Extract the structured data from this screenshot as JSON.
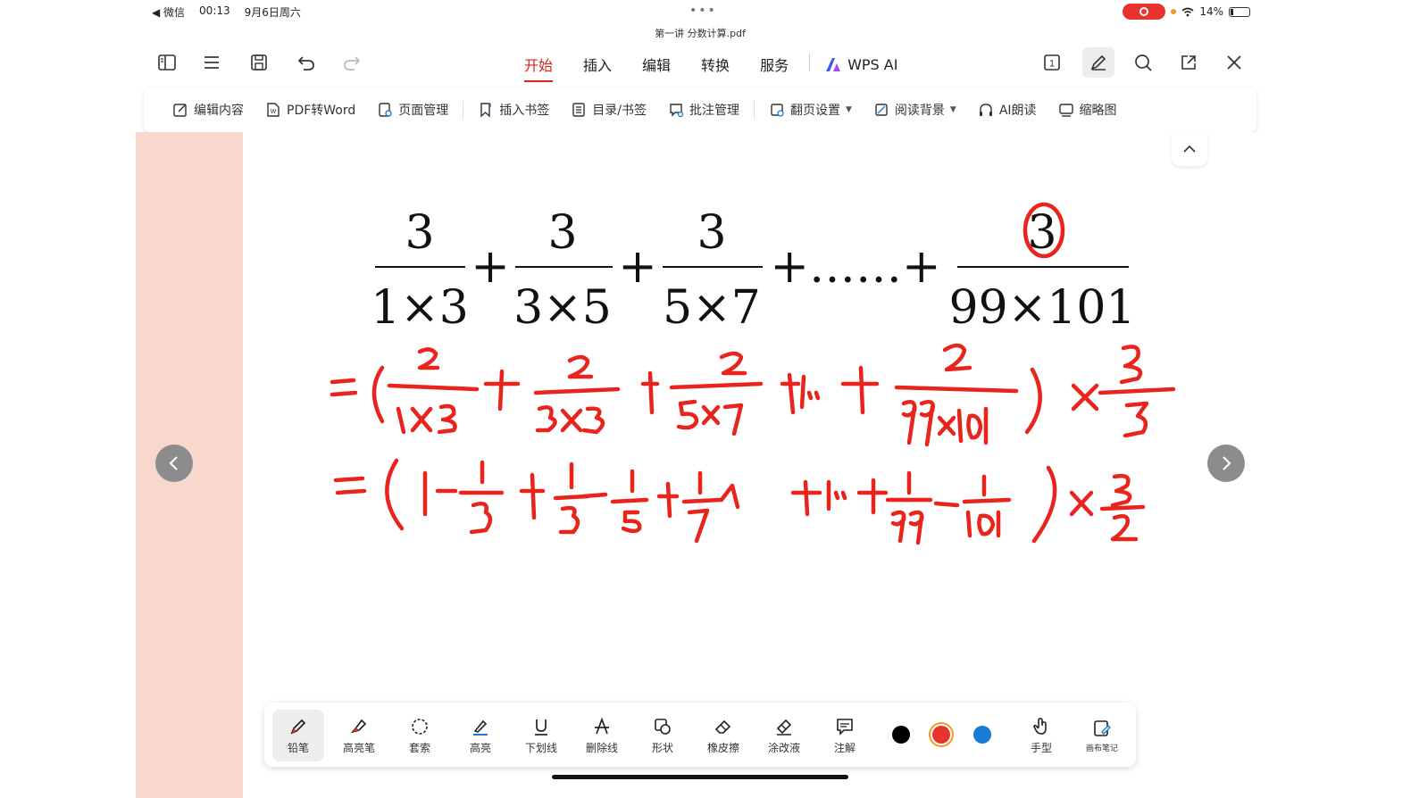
{
  "status_bar": {
    "back_app": "◀ 微信",
    "time": "00:13",
    "date": "9月6日周六",
    "battery": "14%"
  },
  "document": {
    "title": "第一讲 分数计算.pdf"
  },
  "tabs": [
    {
      "label": "开始"
    },
    {
      "label": "插入"
    },
    {
      "label": "编辑"
    },
    {
      "label": "转换"
    },
    {
      "label": "服务"
    },
    {
      "label": "WPS AI"
    }
  ],
  "subtoolbar": [
    {
      "label": "编辑内容",
      "icon": "edit-content-icon"
    },
    {
      "label": "PDF转Word",
      "icon": "pdf-to-word-icon"
    },
    {
      "label": "页面管理",
      "icon": "page-manage-icon"
    },
    {
      "label": "插入书签",
      "icon": "bookmark-add-icon"
    },
    {
      "label": "目录/书签",
      "icon": "toc-icon"
    },
    {
      "label": "批注管理",
      "icon": "annotation-manage-icon"
    },
    {
      "label": "翻页设置",
      "icon": "page-turn-icon"
    },
    {
      "label": "阅读背景",
      "icon": "reading-bg-icon"
    },
    {
      "label": "AI朗读",
      "icon": "headphones-icon"
    },
    {
      "label": "缩略图",
      "icon": "thumbnail-icon"
    }
  ],
  "page_number_badge": "1",
  "formula": {
    "numerators": [
      "3",
      "3",
      "3",
      "3"
    ],
    "denominators": [
      "1×3",
      "3×5",
      "5×7",
      "99×101"
    ],
    "operators": [
      "+",
      "+",
      "+……+"
    ]
  },
  "pen_tools": [
    {
      "label": "铅笔",
      "icon": "pencil-icon"
    },
    {
      "label": "高亮笔",
      "icon": "highlighter-icon"
    },
    {
      "label": "套索",
      "icon": "lasso-icon"
    },
    {
      "label": "高亮",
      "icon": "highlight-icon"
    },
    {
      "label": "下划线",
      "icon": "underline-icon"
    },
    {
      "label": "删除线",
      "icon": "strikethrough-icon"
    },
    {
      "label": "形状",
      "icon": "shape-icon"
    },
    {
      "label": "橡皮擦",
      "icon": "eraser-icon"
    },
    {
      "label": "涂改液",
      "icon": "correction-icon"
    },
    {
      "label": "注解",
      "icon": "comment-icon"
    },
    {
      "label": "手型",
      "icon": "hand-icon"
    },
    {
      "label": "画布笔记",
      "icon": "canvas-note-icon"
    }
  ],
  "colors": {
    "accent": "#d3251f",
    "ink_red": "#e8241c",
    "swatch_black": "#000000",
    "swatch_red": "#e8322e",
    "swatch_blue": "#1a7bd6",
    "sidebar": "#f8d7cd"
  }
}
